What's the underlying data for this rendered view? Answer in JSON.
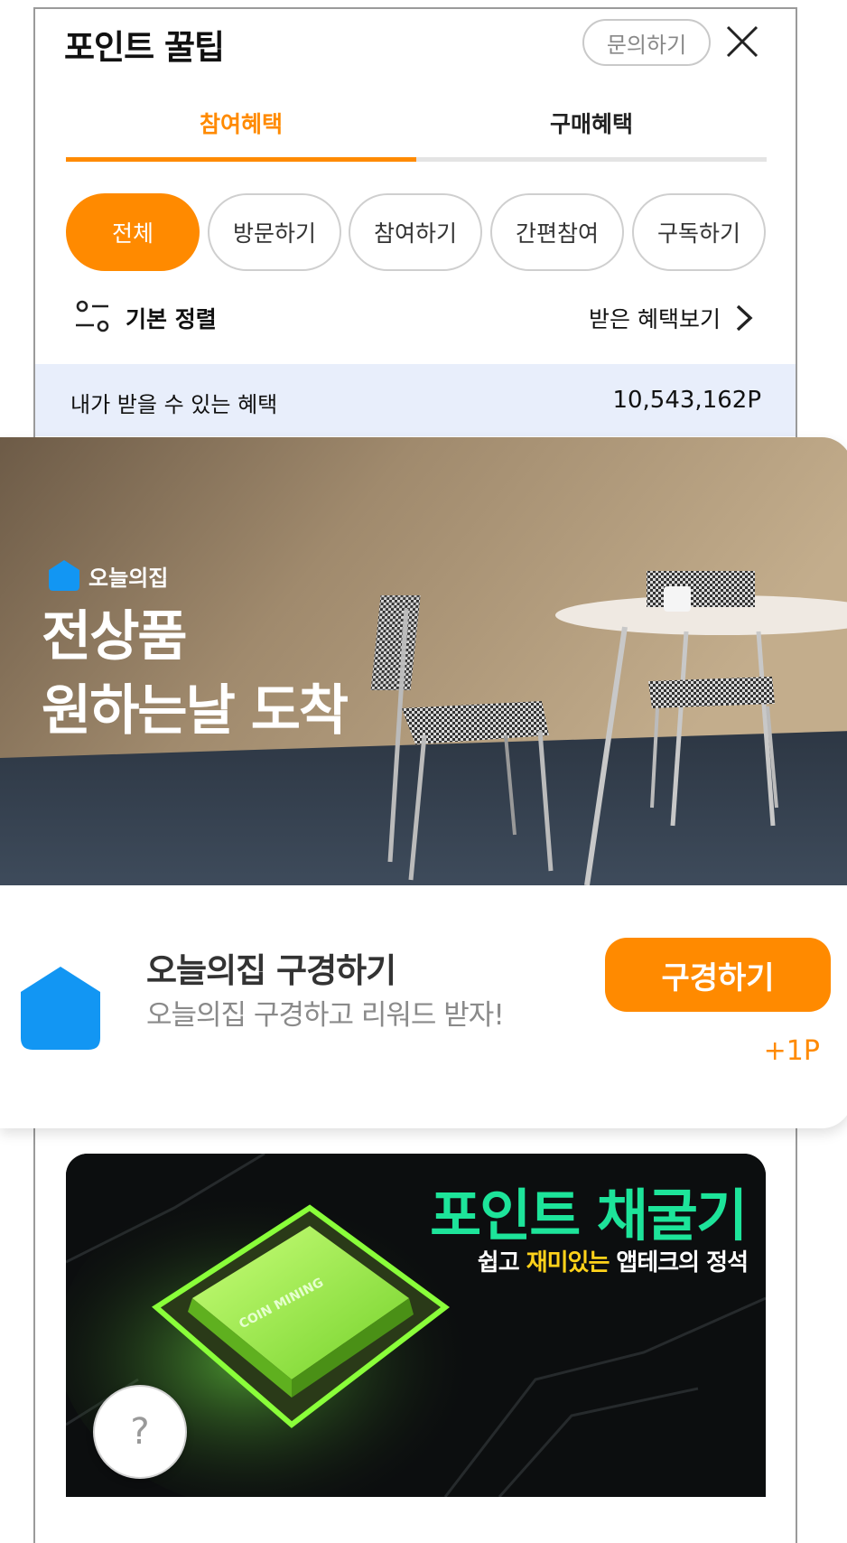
{
  "header": {
    "title": "포인트 꿀팁",
    "inquiry_label": "문의하기"
  },
  "tabs": [
    {
      "label": "참여혜택",
      "active": true
    },
    {
      "label": "구매혜택",
      "active": false
    }
  ],
  "filters": [
    {
      "label": "전체",
      "active": true
    },
    {
      "label": "방문하기",
      "active": false
    },
    {
      "label": "참여하기",
      "active": false
    },
    {
      "label": "간편참여",
      "active": false
    },
    {
      "label": "구독하기",
      "active": false
    }
  ],
  "sort": {
    "label": "기본 정렬",
    "received_link": "받은 혜택보기"
  },
  "summary": {
    "label": "내가 받을 수 있는 혜택",
    "value": "10,543,162P"
  },
  "offer": {
    "brand": "오늘의집",
    "banner_line1": "전상품",
    "banner_line2": "원하는날 도착",
    "title": "오늘의집 구경하기",
    "description": "오늘의집 구경하고 리워드 받자!",
    "button_label": "구경하기",
    "reward": "+1P"
  },
  "mining": {
    "title": "포인트 채굴기",
    "sub_pre": "쉽고 ",
    "sub_highlight": "재미있는",
    "sub_post": " 앱테크의 정석",
    "chip_logo": "COIN MINING"
  },
  "help_label": "?",
  "colors": {
    "accent": "#ff8a00",
    "brand_blue": "#1296f3",
    "mining_green": "#1de49a",
    "highlight_yellow": "#ffd21a",
    "summary_bg": "#e8eefb"
  }
}
